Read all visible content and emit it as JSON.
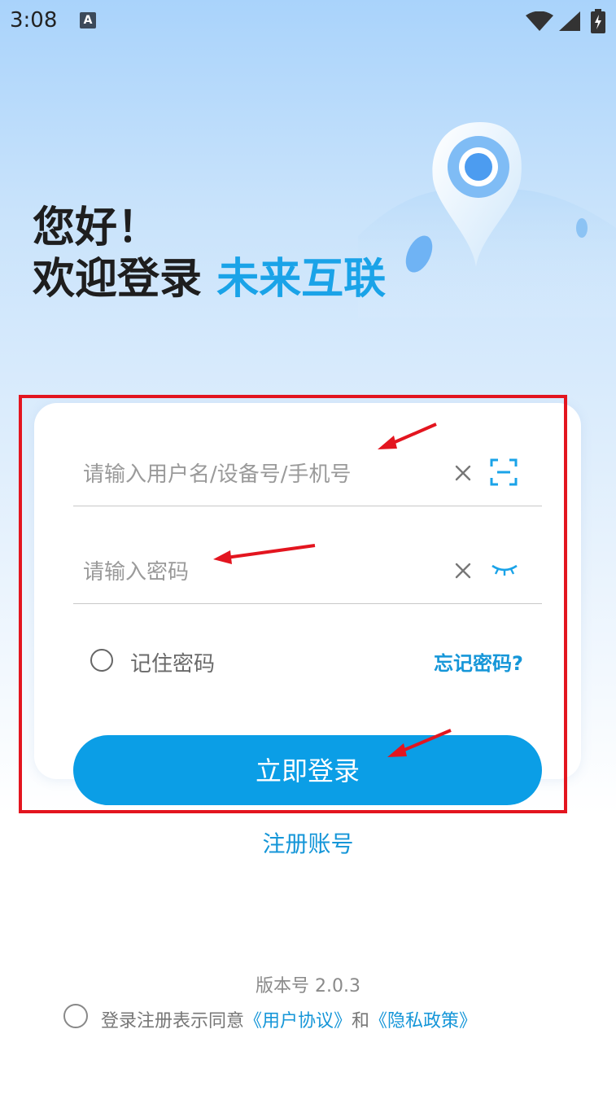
{
  "status_bar": {
    "time": "3:08",
    "notification_badge": "A"
  },
  "header": {
    "greeting": "您好！",
    "welcome_prefix": "欢迎登录",
    "brand_name": "未来互联"
  },
  "login_form": {
    "username": {
      "value": "",
      "placeholder": "请输入用户名/设备号/手机号",
      "clear_icon": "close-icon",
      "scan_icon": "scan-icon"
    },
    "password": {
      "value": "",
      "placeholder": "请输入密码",
      "clear_icon": "close-icon",
      "visibility_icon": "eye-closed-icon"
    },
    "remember_label": "记住密码",
    "forgot_label": "忘记密码?",
    "login_label": "立即登录"
  },
  "register_label": "注册账号",
  "footer": {
    "version": "版本号 2.0.3",
    "agree_text": "登录注册表示同意",
    "user_agreement": "《用户协议》",
    "and_text": "和",
    "privacy_policy": "《隐私政策》"
  },
  "colors": {
    "accent": "#0b9ee6",
    "link": "#1596d8",
    "annotation": "#e3151f"
  }
}
